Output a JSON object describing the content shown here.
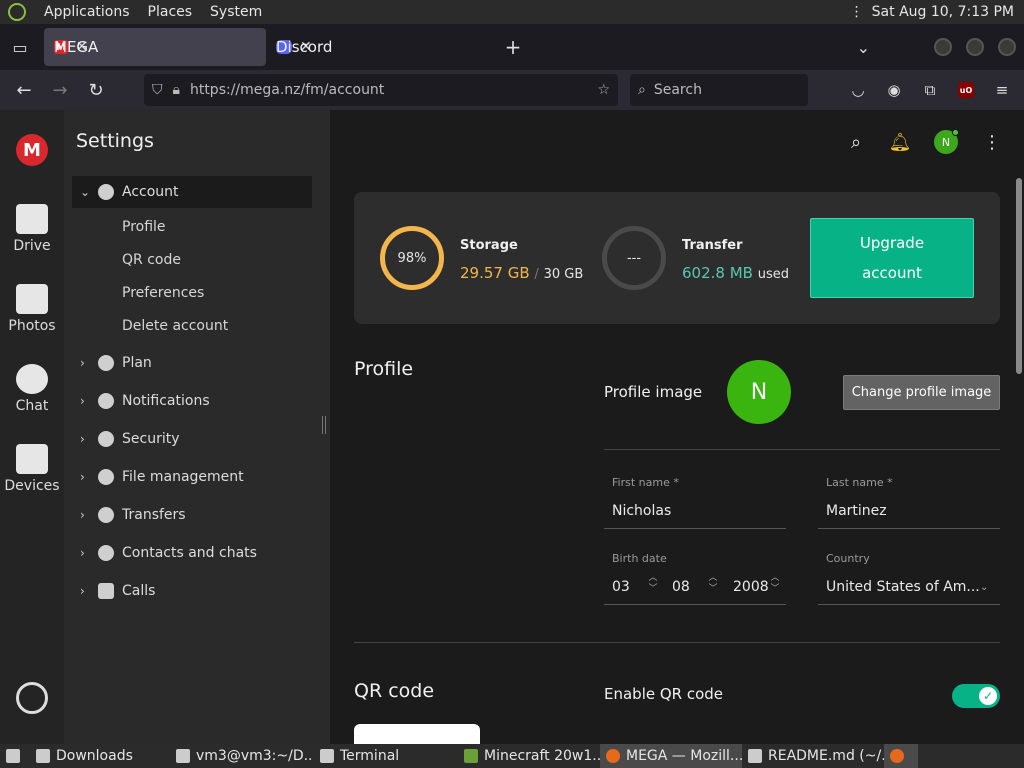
{
  "topbar": {
    "menus": [
      "Applications",
      "Places",
      "System"
    ],
    "clock": "Sat Aug 10,  7:13 PM"
  },
  "browser": {
    "tabs": [
      {
        "label": "MEGA",
        "active": true
      },
      {
        "label": "Discord",
        "active": false
      }
    ],
    "url": "https://mega.nz/fm/account",
    "search_placeholder": "Search"
  },
  "rail": {
    "logo": "M",
    "items": [
      {
        "label": "Drive"
      },
      {
        "label": "Photos"
      },
      {
        "label": "Chat"
      },
      {
        "label": "Devices"
      }
    ]
  },
  "settings": {
    "title": "Settings",
    "account_label": "Account",
    "account_sub": [
      "Profile",
      "QR code",
      "Preferences",
      "Delete account"
    ],
    "items": [
      "Plan",
      "Notifications",
      "Security",
      "File management",
      "Transfers",
      "Contacts and chats",
      "Calls"
    ]
  },
  "header": {
    "avatar_initial": "N"
  },
  "quota": {
    "storage_percent": "98%",
    "storage_label": "Storage",
    "storage_used": "29.57 GB",
    "storage_sep": "/",
    "storage_total": "30 GB",
    "transfer_ring": "---",
    "transfer_label": "Transfer",
    "transfer_used": "602.8 MB",
    "transfer_suffix": "used",
    "upgrade_line1": "Upgrade",
    "upgrade_line2": "account"
  },
  "profile": {
    "section_title": "Profile",
    "image_label": "Profile image",
    "avatar_initial": "N",
    "change_image_button": "Change profile image",
    "first_name_label": "First name *",
    "first_name": "Nicholas",
    "last_name_label": "Last name *",
    "last_name": "Martinez",
    "birth_label": "Birth date",
    "birth_day": "03",
    "birth_month": "08",
    "birth_year": "2008",
    "country_label": "Country",
    "country": "United States of Am..."
  },
  "qr": {
    "section_title": "QR code",
    "enable_label": "Enable QR code",
    "enabled": true
  },
  "taskbar": {
    "items": [
      {
        "label": "Downloads"
      },
      {
        "label": "vm3@vm3:~/D..."
      },
      {
        "label": "Terminal"
      },
      {
        "label": "Minecraft 20w1..."
      },
      {
        "label": "MEGA — Mozill...",
        "active": true
      },
      {
        "label": "README.md (~/..."
      }
    ]
  },
  "colors": {
    "accent_green": "#07b386",
    "storage_orange": "#f3b64c",
    "transfer_teal": "#57c8b1",
    "mega_red": "#d9272e",
    "avatar_green": "#3ab510"
  }
}
